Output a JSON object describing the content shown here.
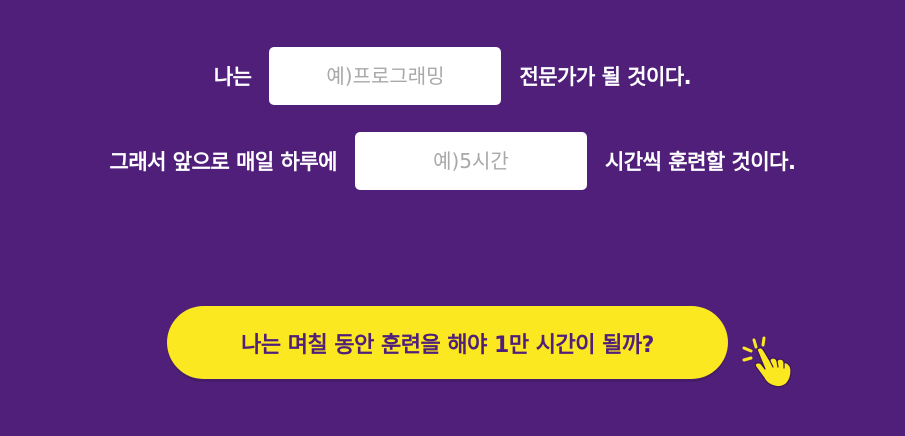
{
  "sentence1": {
    "prefix": "나는",
    "input_placeholder": "예)프로그래밍",
    "input_value": "",
    "suffix": "전문가가 될 것이다."
  },
  "sentence2": {
    "prefix": "그래서 앞으로 매일 하루에",
    "input_placeholder": "예)5시간",
    "input_value": "",
    "suffix": "시간씩 훈련할 것이다."
  },
  "cta": {
    "label": "나는 며칠 동안 훈련을 해야 1만 시간이 될까?"
  },
  "colors": {
    "background": "#4f1f7a",
    "button": "#fbe820",
    "button_text": "#4f1f7a",
    "input_bg": "#ffffff",
    "placeholder": "#a9a9a9"
  },
  "icons": {
    "pointer": "pointing-hand-icon"
  }
}
